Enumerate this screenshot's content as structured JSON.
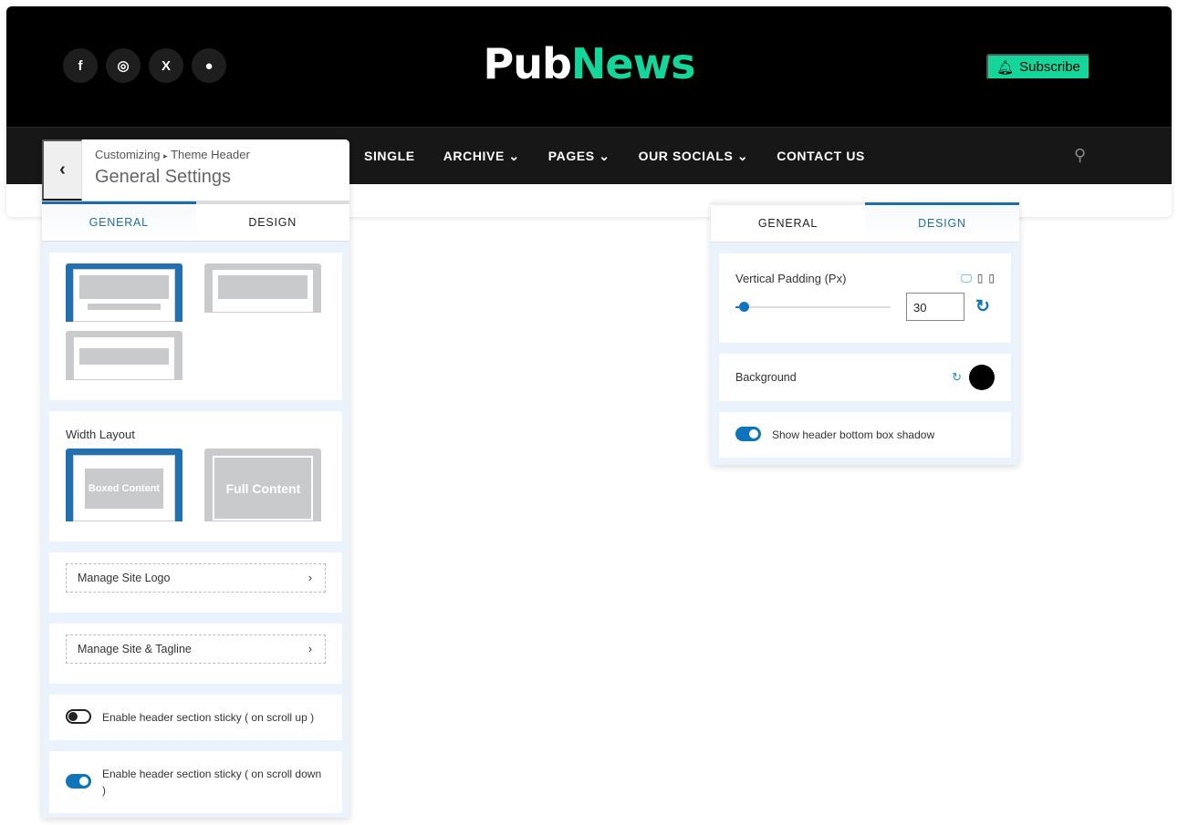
{
  "site": {
    "socials": [
      {
        "icon": "facebook-icon",
        "glyph": "f"
      },
      {
        "icon": "instagram-icon",
        "glyph": "◎"
      },
      {
        "icon": "x-icon",
        "glyph": "X"
      },
      {
        "icon": "github-icon",
        "glyph": "●"
      }
    ],
    "logo_part1": "Pub",
    "logo_part2": "News",
    "subscribe": "Subscribe",
    "nav": [
      "SINGLE",
      "ARCHIVE",
      "PAGES",
      "OUR SOCIALS",
      "CONTACT US"
    ],
    "colors": {
      "accent": "#14d69a",
      "panel_blue": "#1f6da8"
    }
  },
  "left": {
    "breadcrumb": "Customizing",
    "breadcrumb_sep": "▸",
    "breadcrumb_item": "Theme Header",
    "title": "General Settings",
    "tabs": [
      "GENERAL",
      "DESIGN"
    ],
    "width_layout_label": "Width Layout",
    "boxed": "Boxed Content",
    "full": "Full Content",
    "manage_logo": "Manage Site Logo",
    "manage_tagline": "Manage Site & Tagline",
    "sticky_up": "Enable header section sticky ( on scroll up )",
    "sticky_down": "Enable header section sticky ( on scroll down )",
    "sticky_up_on": false,
    "sticky_down_on": true
  },
  "right": {
    "tabs": [
      "GENERAL",
      "DESIGN"
    ],
    "padding_label": "Vertical Padding (Px)",
    "padding_value": "30",
    "background_label": "Background",
    "background_color": "#000000",
    "shadow_label": "Show header bottom box shadow",
    "shadow_on": true
  }
}
